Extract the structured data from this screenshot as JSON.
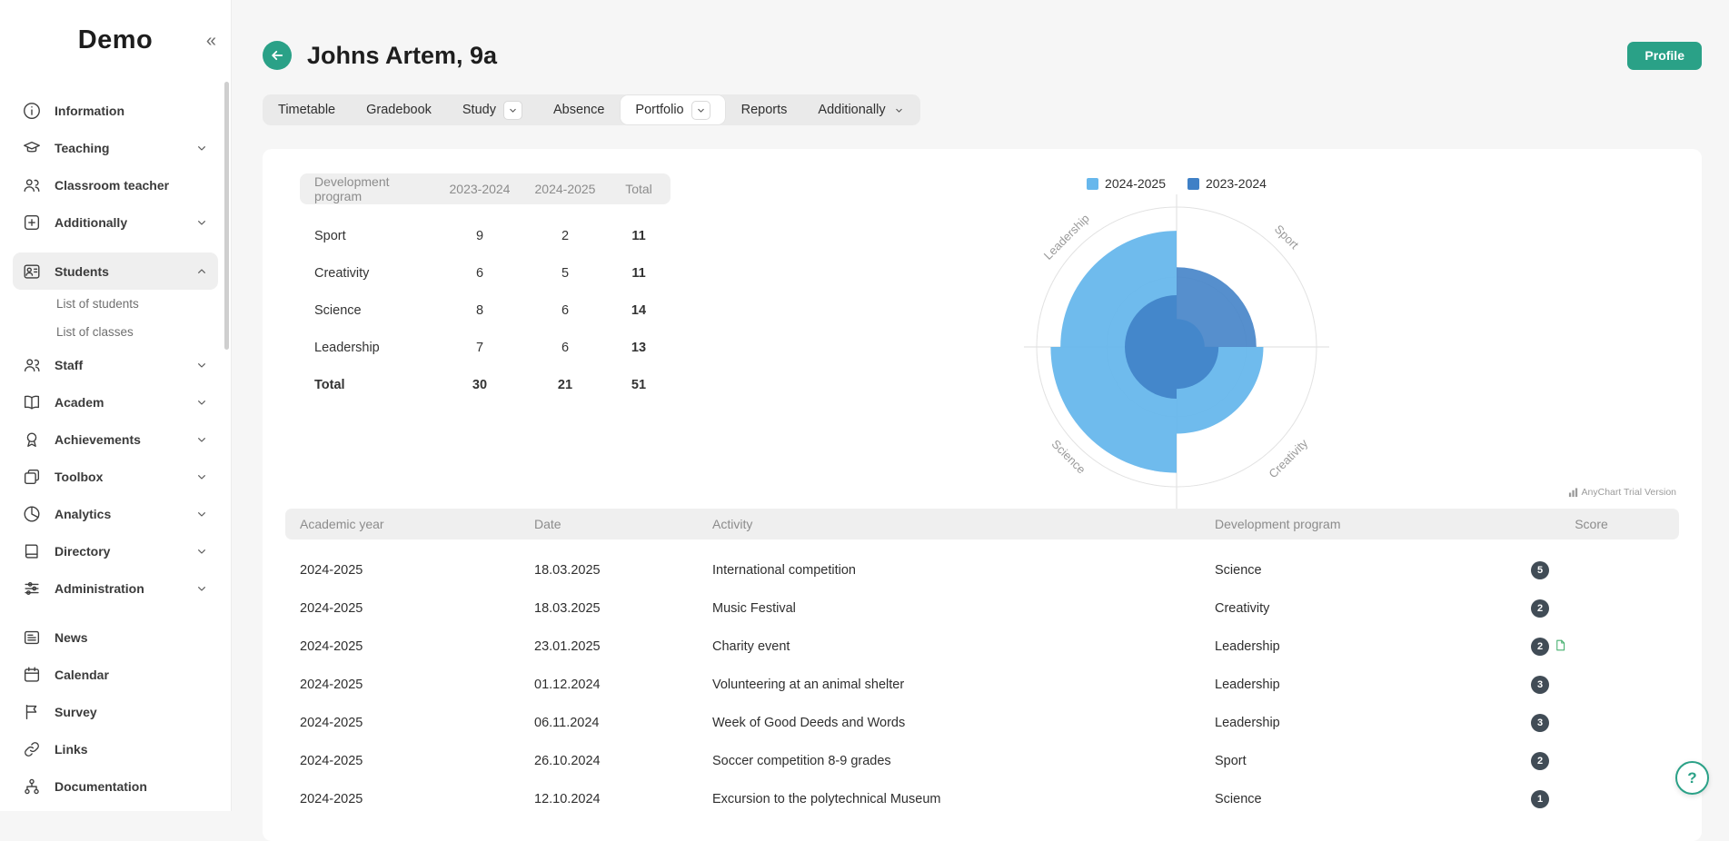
{
  "app": {
    "logo": "Demo",
    "collapse_icon": "«"
  },
  "sidebar": {
    "items": [
      {
        "label": "Information"
      },
      {
        "label": "Teaching"
      },
      {
        "label": "Classroom teacher"
      },
      {
        "label": "Additionally"
      },
      {
        "label": "Students"
      },
      {
        "label": "List of students"
      },
      {
        "label": "List of classes"
      },
      {
        "label": "Staff"
      },
      {
        "label": "Academ"
      },
      {
        "label": "Achievements"
      },
      {
        "label": "Toolbox"
      },
      {
        "label": "Analytics"
      },
      {
        "label": "Directory"
      },
      {
        "label": "Administration"
      },
      {
        "label": "News"
      },
      {
        "label": "Calendar"
      },
      {
        "label": "Survey"
      },
      {
        "label": "Links"
      },
      {
        "label": "Documentation"
      }
    ]
  },
  "header": {
    "title": "Johns Artem, 9a",
    "profile_button": "Profile"
  },
  "tabs": [
    {
      "label": "Timetable"
    },
    {
      "label": "Gradebook"
    },
    {
      "label": "Study"
    },
    {
      "label": "Absence"
    },
    {
      "label": "Portfolio"
    },
    {
      "label": "Reports"
    },
    {
      "label": "Additionally"
    }
  ],
  "summary_table": {
    "headers": [
      "Development program",
      "2023-2024",
      "2024-2025",
      "Total"
    ],
    "rows": [
      {
        "program": "Sport",
        "y2023": "9",
        "y2024": "2",
        "total": "11"
      },
      {
        "program": "Creativity",
        "y2023": "6",
        "y2024": "5",
        "total": "11"
      },
      {
        "program": "Science",
        "y2023": "8",
        "y2024": "6",
        "total": "14"
      },
      {
        "program": "Leadership",
        "y2023": "7",
        "y2024": "6",
        "total": "13"
      },
      {
        "program": "Total",
        "y2023": "30",
        "y2024": "21",
        "total": "51"
      }
    ]
  },
  "chart": {
    "legend": [
      {
        "label": "2024-2025",
        "color": "#67b7ec"
      },
      {
        "label": "2023-2024",
        "color": "#3f80c6"
      }
    ],
    "axes": [
      "Sport",
      "Creativity",
      "Science",
      "Leadership"
    ],
    "watermark": "AnyChart Trial Version",
    "chart_data": {
      "type": "polar-column",
      "categories": [
        "Sport",
        "Creativity",
        "Science",
        "Leadership"
      ],
      "series": [
        {
          "name": "2023-2024",
          "values": [
            9,
            6,
            8,
            7
          ]
        },
        {
          "name": "2024-2025",
          "values": [
            2,
            5,
            6,
            6
          ]
        }
      ]
    },
    "visual": {
      "series": [
        {
          "color": "#67b7ec",
          "opacity": 0.95,
          "fractions": [
            0.2,
            0.62,
            0.9,
            0.83
          ]
        },
        {
          "color": "#3f80c6",
          "opacity": 0.88,
          "fractions": [
            0.57,
            0.3,
            0.37,
            0.37
          ]
        }
      ]
    }
  },
  "activities": {
    "headers": [
      "Academic year",
      "Date",
      "Activity",
      "Development program",
      "Score"
    ],
    "rows": [
      {
        "year": "2024-2025",
        "date": "18.03.2025",
        "activity": "International competition",
        "program": "Science",
        "score": "5"
      },
      {
        "year": "2024-2025",
        "date": "18.03.2025",
        "activity": "Music Festival",
        "program": "Creativity",
        "score": "2"
      },
      {
        "year": "2024-2025",
        "date": "23.01.2025",
        "activity": "Charity event",
        "program": "Leadership",
        "score": "2"
      },
      {
        "year": "2024-2025",
        "date": "01.12.2024",
        "activity": "Volunteering at an animal shelter",
        "program": "Leadership",
        "score": "3"
      },
      {
        "year": "2024-2025",
        "date": "06.11.2024",
        "activity": "Week of Good Deeds and Words",
        "program": "Leadership",
        "score": "3"
      },
      {
        "year": "2024-2025",
        "date": "26.10.2024",
        "activity": "Soccer competition 8-9 grades",
        "program": "Sport",
        "score": "2"
      },
      {
        "year": "2024-2025",
        "date": "12.10.2024",
        "activity": "Excursion to the polytechnical Museum",
        "program": "Science",
        "score": "1"
      }
    ]
  },
  "help_button": "?"
}
